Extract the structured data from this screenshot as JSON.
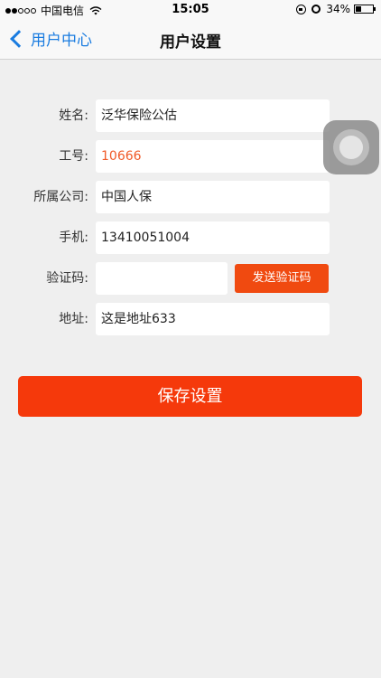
{
  "status_bar": {
    "carrier": "中国电信",
    "time": "15:05",
    "battery": "34%",
    "battery_level": 0.34
  },
  "navbar": {
    "back_label": "用户中心",
    "title": "用户设置"
  },
  "form": {
    "name_label": "姓名:",
    "name_value": "泛华保险公估",
    "id_label": "工号:",
    "id_value": "10666",
    "company_label": "所属公司:",
    "company_value": "中国人保",
    "phone_label": "手机:",
    "phone_value": "13410051004",
    "code_label": "验证码:",
    "code_value": "",
    "send_code_label": "发送验证码",
    "address_label": "地址:",
    "address_value": "这是地址633"
  },
  "save_label": "保存设置",
  "colors": {
    "accent": "#f5390b",
    "link": "#1a7ce0",
    "id_text": "#f05a28"
  },
  "icons": [
    "signal-dots-icon",
    "wifi-icon",
    "rotation-lock-icon",
    "alarm-icon",
    "battery-icon",
    "back-chevron-icon",
    "assistive-touch-icon"
  ]
}
